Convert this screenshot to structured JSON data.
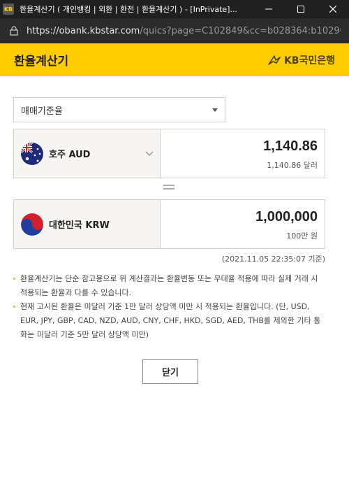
{
  "window": {
    "icon_text": "KB",
    "title": "환율계산기 ( 개인뱅킹 | 외환 | 환전 | 환율계산기 ) - [InPrivate]..."
  },
  "address_bar": {
    "url_host": "https://obank.kbstar.com",
    "url_rest": "/quics?page=C102849&cc=b028364:b10290..."
  },
  "header": {
    "title": "환율계산기",
    "brand": "KB국민은행",
    "accent_color": "#ffcc00"
  },
  "rate_type": {
    "selected": "매매기준율"
  },
  "from_currency": {
    "flag_icon": "australia-flag-icon",
    "name": "호주 AUD",
    "amount": "1,140.86",
    "amount_text": "1,140.86 달러"
  },
  "to_currency": {
    "flag_icon": "korea-flag-icon",
    "name": "대한민국 KRW",
    "amount": "1,000,000",
    "amount_text": "100만 원"
  },
  "timestamp": "(2021.11.05 22:35:07 기준)",
  "notes": [
    "환율계산기는 단순 참고용으로 위 계산결과는 환율변동 또는 우대율 적용에 따라 실제 거래 시 적용되는 환율과 다를 수 있습니다.",
    "현재 고시된 환율은 미달러 기준 1만 달러 상당액 미만 시 적용되는 환율입니다. (단, USD, EUR, JPY, GBP, CAD, NZD, AUD, CNY, CHF, HKD, SGD, AED, THB를 제외한 기타 통화는 미달러 기준 5만 달러 상당액 미만)"
  ],
  "close_button": "닫기"
}
